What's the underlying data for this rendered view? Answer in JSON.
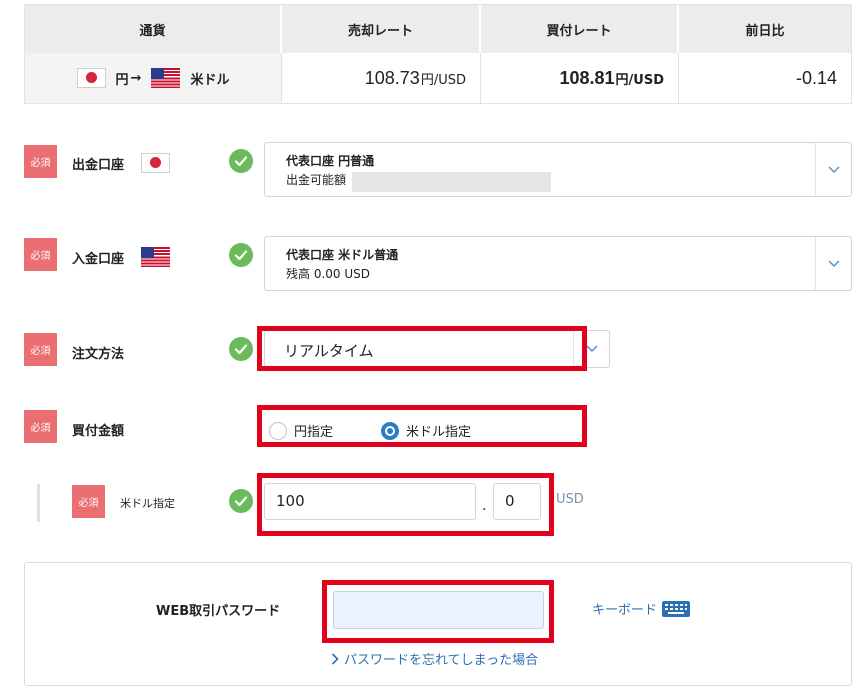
{
  "rate_table": {
    "headers": [
      "通貨",
      "売却レート",
      "買付レート",
      "前日比"
    ],
    "pair": {
      "from": "円",
      "arrow": "→",
      "to": "米ドル"
    },
    "sell_rate": {
      "value": "108.73",
      "unit": "円/USD"
    },
    "buy_rate": {
      "value": "108.81",
      "unit": "円/USD"
    },
    "change": "-0.14"
  },
  "required_badge": "必須",
  "withdraw": {
    "label": "出金口座",
    "account": "代表口座 円普通",
    "detail": "出金可能額"
  },
  "deposit": {
    "label": "入金口座",
    "account": "代表口座 米ドル普通",
    "detail": "残高 0.00 USD"
  },
  "order_method": {
    "label": "注文方法",
    "value": "リアルタイム"
  },
  "purchase_amount": {
    "label": "買付金額",
    "options": [
      "円指定",
      "米ドル指定"
    ],
    "selected": "米ドル指定"
  },
  "usd_amount": {
    "label": "米ドル指定",
    "integer": "100",
    "decimal": "0",
    "unit": "USD"
  },
  "password": {
    "label": "WEB取引パスワード",
    "keyboard": "キーボード",
    "forgot": "パスワードを忘れてしまった場合"
  },
  "colors": {
    "required": "#ea6e72",
    "check": "#6bbb5a",
    "highlight": "#e3001b",
    "link": "#2b6fb4"
  }
}
